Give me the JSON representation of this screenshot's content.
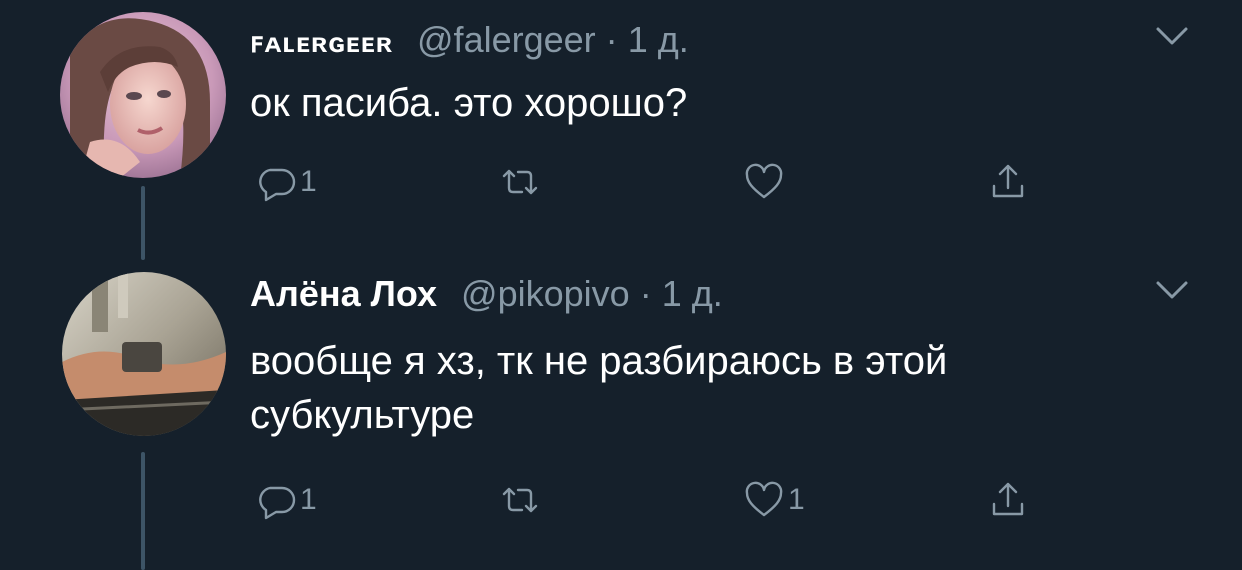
{
  "colors": {
    "background": "#15202b",
    "primary_text": "#ffffff",
    "secondary_text": "#8899a6",
    "thread_line": "#3d5466"
  },
  "tweets": [
    {
      "display_name": "ꜰᴀʟᴇʀɢᴇᴇʀ",
      "handle": "@falergeer",
      "separator": "·",
      "time": "1 д.",
      "text": "ок пасиба. это хорошо?",
      "avatar_icon": "avatar-photo-girl",
      "menu_icon": "chevron-down-icon",
      "actions": {
        "reply": {
          "icon": "reply-bubble-icon",
          "count": "1"
        },
        "retweet": {
          "icon": "retweet-icon",
          "count": ""
        },
        "like": {
          "icon": "heart-icon",
          "count": ""
        },
        "share": {
          "icon": "share-icon",
          "count": ""
        }
      }
    },
    {
      "display_name": "Алёна Лох",
      "handle": "@pikopivo",
      "separator": "·",
      "time": "1 д.",
      "text": "вообще я хз, тк не разбираюсь в этой\nсубкультуре",
      "avatar_icon": "avatar-photo-mirror",
      "menu_icon": "chevron-down-icon",
      "actions": {
        "reply": {
          "icon": "reply-bubble-icon",
          "count": "1"
        },
        "retweet": {
          "icon": "retweet-icon",
          "count": ""
        },
        "like": {
          "icon": "heart-icon",
          "count": "1"
        },
        "share": {
          "icon": "share-icon",
          "count": ""
        }
      }
    }
  ]
}
